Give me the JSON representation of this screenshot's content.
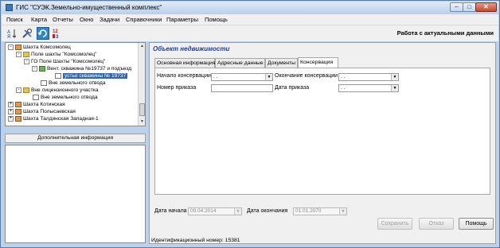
{
  "window": {
    "title": "ГИС \"СУЭК.Земельно-имущественный комплекс\""
  },
  "menu": [
    "Поиск",
    "Карта",
    "Отчеты",
    "Окно",
    "Задачи",
    "Справочники",
    "Параметры",
    "Помощь"
  ],
  "toolbar": {
    "mode_label": "Работа с актуальными данными",
    "icons": [
      "sort-az-icon",
      "tools-icon",
      "refresh-icon",
      "numbering-icon"
    ]
  },
  "tree": {
    "items": [
      {
        "label": "Шахта Комсомолец",
        "expander": "-"
      },
      {
        "label": "Поле шахты \"Комсомолец\"",
        "expander": "-"
      },
      {
        "label": "ГО  Поле Шахты \"Комсомолец\"",
        "expander": "-"
      },
      {
        "label": "Вент. скважина №19737 и подъезд",
        "expander": "-"
      },
      {
        "label": "устье скважины № 19737",
        "expander": ""
      },
      {
        "label": "Вне земельного отвода",
        "expander": ""
      },
      {
        "label": "Вне лицензионного участка",
        "expander": "-"
      },
      {
        "label": "Вне земельного отвода",
        "expander": ""
      },
      {
        "label": "Шахта Котинская",
        "expander": "+"
      },
      {
        "label": "Шахта Полысаевская",
        "expander": "+"
      },
      {
        "label": "Шахта Талдинская Западная-1",
        "expander": "+"
      }
    ]
  },
  "additional_info": {
    "header": "Дополнительная информация"
  },
  "object": {
    "title": "Объект недвижимости",
    "tabs": [
      "Основная информация",
      "Адресные данные",
      "Документы",
      "Консервация"
    ],
    "active_tab": "Консервация",
    "fields": {
      "start_label": "Начало консервации",
      "start_value": ". .",
      "end_label": "Окончание консервации",
      "end_value": ". .",
      "order_no_label": "Номер приказа",
      "order_no_value": "",
      "order_date_label": "Дата приказа",
      "order_date_value": ". ."
    },
    "date_start_label": "Дата начала",
    "date_start_value": "09.04.2014",
    "date_end_label": "Дата окончания",
    "date_end_value": "01.01.2070",
    "buttons": {
      "save": "Сохранить",
      "cancel": "Отказ",
      "help": "Помощь"
    },
    "id_line": "Идентификационный номер: 15381"
  }
}
